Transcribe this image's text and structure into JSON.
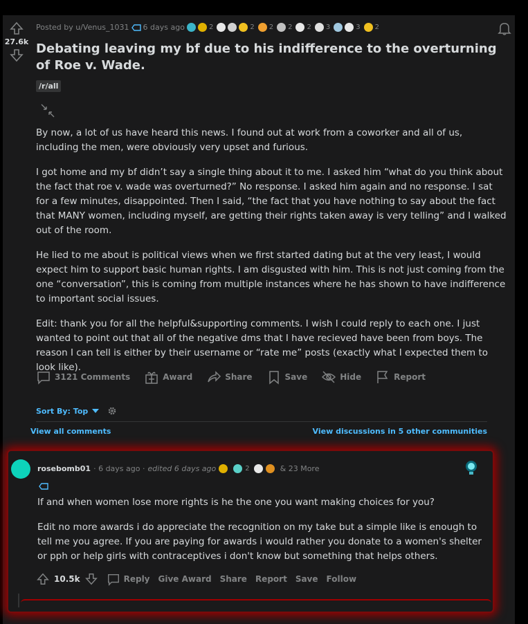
{
  "post": {
    "score": "27.6k",
    "posted_by": "Posted by u/Venus_1031",
    "time": "6 days ago",
    "awards": [
      {
        "icon": "award-teal-icon",
        "count": "",
        "color": "#3bb4c8"
      },
      {
        "icon": "award-gold-icon",
        "count": "2",
        "color": "#e0b000"
      },
      {
        "icon": "award-face-icon",
        "count": "",
        "color": "#e8e8e8"
      },
      {
        "icon": "award-rocket-icon",
        "count": "",
        "color": "#d0d0d0"
      },
      {
        "icon": "award-burst-icon",
        "count": "2",
        "color": "#f0c020"
      },
      {
        "icon": "award-hand-icon",
        "count": "2",
        "color": "#f0a030"
      },
      {
        "icon": "award-cat-icon",
        "count": "2",
        "color": "#c0c0c0"
      },
      {
        "icon": "award-bubble-icon",
        "count": "2",
        "color": "#e8e8e8"
      },
      {
        "icon": "award-dollar-icon",
        "count": "3",
        "color": "#e0e0e0"
      },
      {
        "icon": "award-snow-icon",
        "count": "",
        "color": "#a0c8e0"
      },
      {
        "icon": "award-bowl-icon",
        "count": "3",
        "color": "#e8e8e8"
      },
      {
        "icon": "award-laugh-icon",
        "count": "2",
        "color": "#f0c020"
      }
    ],
    "title": "Debating leaving my bf due to his indifference to the overturning of Roe v. Wade.",
    "flair": "/r/all",
    "paragraphs": [
      "By now, a lot of us have heard this news. I found out at work from a coworker and all of us, including the men, were obviously very upset and furious.",
      "I got home and my bf didn’t say a single thing about it to me. I asked him “what do you think about the fact that roe v. wade was overturned?” No response. I asked him again and no response. I sat for a few minutes, disappointed. Then I said, “the fact that you have nothing to say about the fact that MANY women, including myself, are getting their rights taken away is very telling” and I walked out of the room.",
      "He lied to me about is political views when we first started dating but at the very least, I would expect him to support basic human rights. I am disgusted with him. This is not just coming from the one “conversation”, this is coming from multiple instances where he has shown to have indifference to important social issues.",
      "Edit: thank you for all the helpful&supporting comments. I wish I could reply to each one. I just wanted to point out that all of the negative dms that I have recieved have been from boys. The reason I can tell is either by their username or “rate me” posts (exactly what I expected them to look like)."
    ],
    "actions": {
      "comments": "3121 Comments",
      "award": "Award",
      "share": "Share",
      "save": "Save",
      "hide": "Hide",
      "report": "Report"
    }
  },
  "sort": {
    "label": "Sort By: Top"
  },
  "links": {
    "view_all": "View all comments",
    "view_discussions": "View discussions in 5 other communities"
  },
  "comment": {
    "user": "rosebomb01",
    "time": "· 6 days ago ·",
    "edited": "edited 6 days ago",
    "awards_count": "2",
    "more": "& 23 More",
    "paragraphs": [
      "If and when women lose more rights is he the one you want making choices for you?",
      "Edit no more awards i do appreciate the recognition on my take but a simple like is enough to tell me you agree. If you are paying for awards i would rather you donate to a women's shelter or pph or help girls with contraceptives i don't know but something that helps others."
    ],
    "score": "10.5k",
    "actions": {
      "reply": "Reply",
      "give_award": "Give Award",
      "share": "Share",
      "report": "Report",
      "save": "Save",
      "follow": "Follow"
    }
  }
}
